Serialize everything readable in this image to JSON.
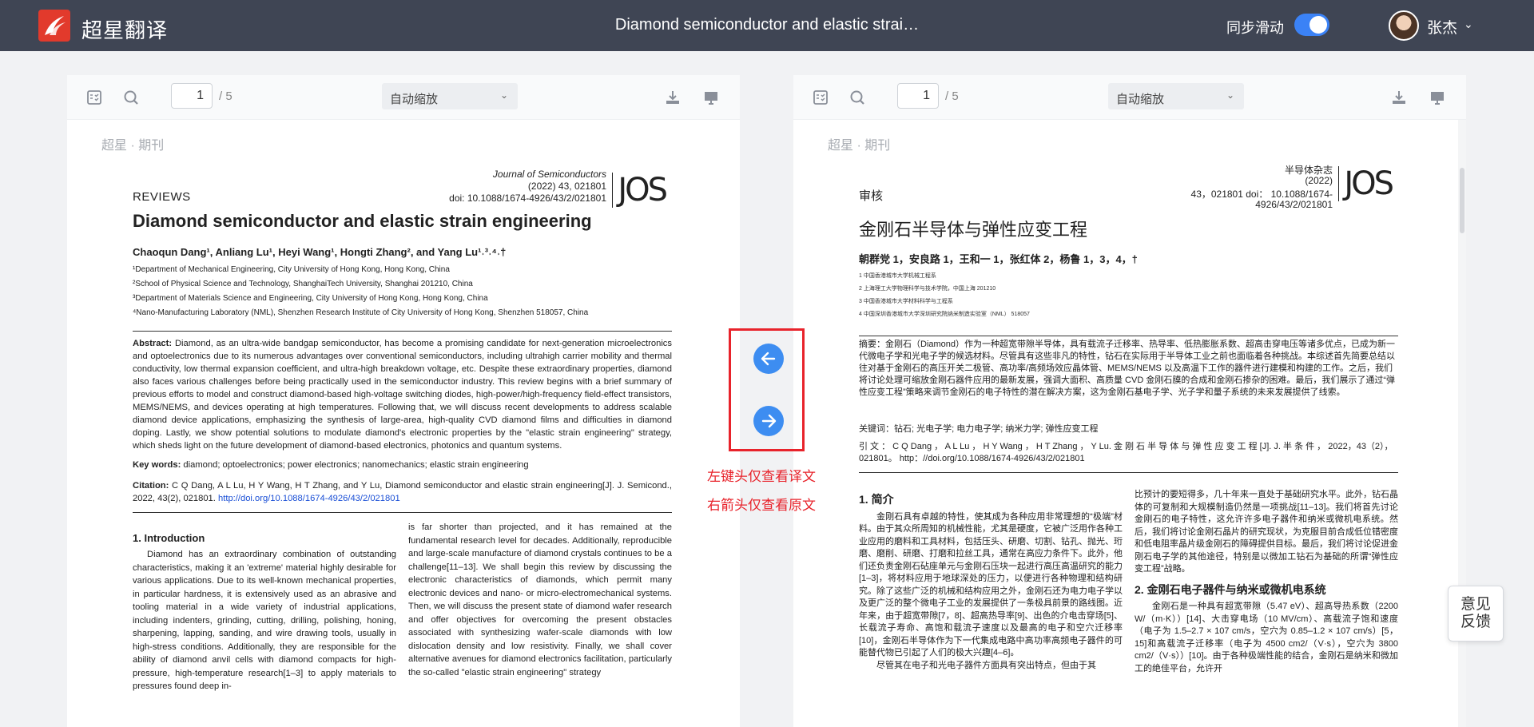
{
  "header": {
    "brand": "超星翻译",
    "doc_title": "Diamond semiconductor and elastic strai…",
    "sync_label": "同步滑动",
    "sync_enabled": true,
    "user_name": "张杰",
    "user_caret": "⌄"
  },
  "viewer": {
    "page_current": "1",
    "page_total": "/ 5",
    "zoom": "自动缩放",
    "zoom_chevron": "⌄"
  },
  "original": {
    "watermark": "超星 · 期刊",
    "journal": "Journal of Semiconductors",
    "journal_vol": "(2022) 43, 021801",
    "journal_doi": "doi: 10.1088/1674-4926/43/2/021801",
    "jos": "JOS",
    "section": "REVIEWS",
    "title": "Diamond semiconductor and elastic strain engineering",
    "authors": "Chaoqun Dang¹, Anliang Lu¹, Heyi Wang¹, Hongti Zhang², and Yang Lu¹˒³˒⁴˒†",
    "affiliations": [
      "¹Department of Mechanical Engineering, City University of Hong Kong, Hong Kong, China",
      "²School of Physical Science and Technology, ShanghaiTech University, Shanghai 201210, China",
      "³Department of Materials Science and Engineering, City University of Hong Kong, Hong Kong, China",
      "⁴Nano-Manufacturing Laboratory (NML), Shenzhen Research Institute of City University of Hong Kong, Shenzhen 518057, China"
    ],
    "abstract_label": "Abstract:",
    "abstract": " Diamond, as an ultra-wide bandgap semiconductor, has become a promising candidate for next-generation microelectronics and optoelectronics due to its numerous advantages over conventional semiconductors, including ultrahigh carrier mobility and thermal conductivity, low thermal expansion coefficient, and ultra-high breakdown voltage, etc. Despite these extraordinary properties, diamond also faces various challenges before being practically used in the semiconductor industry. This review begins with a brief summary of previous efforts to model and construct diamond-based high-voltage switching diodes, high-power/high-frequency field-effect transistors, MEMS/NEMS, and devices operating at high temperatures. Following that, we will discuss recent developments to address scalable diamond device applications, emphasizing the synthesis of large-area, high-quality CVD diamond films and difficulties in diamond doping. Lastly, we show potential solutions to modulate diamond's electronic properties by the \"elastic strain engineering\" strategy, which sheds light on the future development of diamond-based electronics, photonics and quantum systems.",
    "keywords_label": "Key words:",
    "keywords": " diamond; optoelectronics; power electronics; nanomechanics; elastic strain engineering",
    "citation_label": "Citation:",
    "citation": " C Q Dang, A L Lu, H Y Wang, H T Zhang, and Y Lu, Diamond semiconductor and elastic strain engineering[J]. J. Semicond., 2022, 43(2), 021801.",
    "citation_link": "http://doi.org/10.1088/1674-4926/43/2/021801",
    "intro_heading": "1.  Introduction",
    "intro_col1": "Diamond has an extraordinary combination of outstanding characteristics, making it an 'extreme' material highly desirable for various applications. Due to its well-known mechanical properties, in particular hardness, it is extensively used as an abrasive and tooling material in a wide variety of industrial applications, including indenters, grinding, cutting, drilling, polishing, honing, sharpening, lapping, sanding, and wire drawing tools, usually in high-stress conditions. Additionally, they are responsible for the ability of diamond anvil cells with diamond compacts for high-pressure, high-temperature research[1–3] to apply materials to pressures found deep in-",
    "intro_col2": "is far shorter than projected, and it has remained at the fundamental research level for decades. Additionally, reproducible and large-scale manufacture of diamond crystals continues to be a challenge[11–13]. We shall begin this review by discussing the electronic characteristics of diamonds, which permit many electronic devices and nano- or micro-electromechanical systems. Then, we will discuss the present state of diamond wafer research and offer objectives for overcoming the present obstacles associated with synthesizing wafer-scale diamonds with low dislocation density and low resistivity. Finally, we shall cover alternative avenues for diamond electronics facilitation, particularly the so-called \"elastic strain engineering\" strategy"
  },
  "translated": {
    "watermark": "超星 · 期刊",
    "journal": "半导体杂志",
    "journal_vol": "(2022)",
    "journal_doi_1": "43，021801 doi：  10.1088/1674-",
    "journal_doi_2": "4926/43/2/021801",
    "jos": "JOS",
    "section": "审核",
    "title": "金刚石半导体与弹性应变工程",
    "authors": "朝群党 1，安良路 1，王和一 1，张红体 2，杨鲁 1，3，4，†",
    "affiliations": [
      "1 中国香港城市大学机械工程系",
      "2 上海理工大学物理科学与技术学院，中国上海 201210",
      "3 中国香港城市大学材料科学与工程系",
      "4 中国深圳香港城市大学深圳研究院纳米制造实验室（NML） 518057"
    ],
    "abstract": "摘要：金刚石（Diamond）作为一种超宽带隙半导体，具有载流子迁移率、热导率、低热膨胀系数、超高击穿电压等诸多优点，已成为新一代微电子学和光电子学的候选材料。尽管具有这些非凡的特性，钻石在实际用于半导体工业之前也面临着各种挑战。本综述首先简要总结以往对基于金刚石的高压开关二极管、高功率/高频场效应晶体管、MEMS/NEMS 以及高温下工作的器件进行建模和构建的工作。之后，我们将讨论处理可缩放金刚石器件应用的最新发展，强调大面积、高质量 CVD 金刚石膜的合成和金刚石掺杂的困难。最后，我们展示了通过“弹性应变工程”策略来调节金刚石的电子特性的潜在解决方案，这为金刚石基电子学、光子学和量子系统的未来发展提供了线索。",
    "keywords": "关键词：钻石; 光电子学; 电力电子学; 纳米力学; 弹性应变工程",
    "citation": "引 文 ： C Q Dang ， A L Lu ， H Y Wang ， H T Zhang ， Y Lu. 金 刚 石 半 导 体 与 弹 性 应 变 工 程 [J]. J.  半 条 件 ， 2022，43（2），021801。 http：//doi.org/10.1088/1674-4926/43/2/021801",
    "intro_heading": "1.  简介",
    "intro_col1": "金刚石具有卓越的特性，使其成为各种应用非常理想的“极端”材料。由于其众所周知的机械性能，尤其是硬度，它被广泛用作各种工业应用的磨料和工具材料，包括压头、研磨、切割、钻孔、抛光、珩磨、磨削、研磨、打磨和拉丝工具，通常在高应力条件下。此外，他们还负责金刚石砧座单元与金刚石压块一起进行高压高温研究的能力[1–3]，将材料应用于地球深处的压力，以便进行各种物理和结构研究。除了这些广泛的机械和结构应用之外，金刚石还为电力电子学以及更广泛的整个微电子工业的发展提供了一条极具前景的路线图。近年来，由于超宽带隙[7，8]、超高热导率[9]、出色的介电击穿场[5]、长载流子寿命、高饱和载流子速度以及最高的电子和空穴迁移率[10]，金刚石半导体作为下一代集成电路中高功率高频电子器件的可能替代物已引起了人们的极大兴趣[4–6]。",
    "intro_col1_tail": "尽管其在电子和光电子器件方面具有突出特点，但由于其",
    "intro_col2": "比预计的要短得多，几十年来一直处于基础研究水平。此外，钻石晶体的可复制和大规模制造仍然是一项挑战[11–13]。我们将首先讨论金刚石的电子特性，这允许许多电子器件和纳米或微机电系统。然后，我们将讨论金刚石晶片的研究现状，为克服目前合成低位错密度和低电阻率晶片级金刚石的障碍提供目标。最后，我们将讨论促进金刚石电子学的其他途径，特别是以微加工钻石为基础的所谓“弹性应变工程”战略。",
    "section2_heading": "2.  金刚石电子器件与纳米或微机电系统",
    "section2_text": "金刚石是一种具有超宽带隙（5.47 eV）、超高导热系数（2200 W/（m·K））[14]、大击穿电场（10 MV/cm）、高载流子饱和速度（电子为 1.5–2.7 × 107 cm/s，空穴为 0.85–1.2 × 107 cm/s）[5，15]和高载流子迁移率（电子为 4500 cm2/（V·s），空穴为 3800 cm2/（V·s））[10]。由于各种极端性能的结合，金刚石是纳米和微加工的绝佳平台，允许开"
  },
  "navigation": {
    "hint_left": "左键头仅查看译文",
    "hint_right": "右箭头仅查看原文",
    "prev_label": "←",
    "next_label": "→"
  },
  "feedback": {
    "line1": "意见",
    "line2": "反馈"
  },
  "colors": {
    "topbar": "#3f4554",
    "accent": "#3d8df1",
    "highlight_border": "#e8232b",
    "toggle_on": "#3b82f6"
  }
}
